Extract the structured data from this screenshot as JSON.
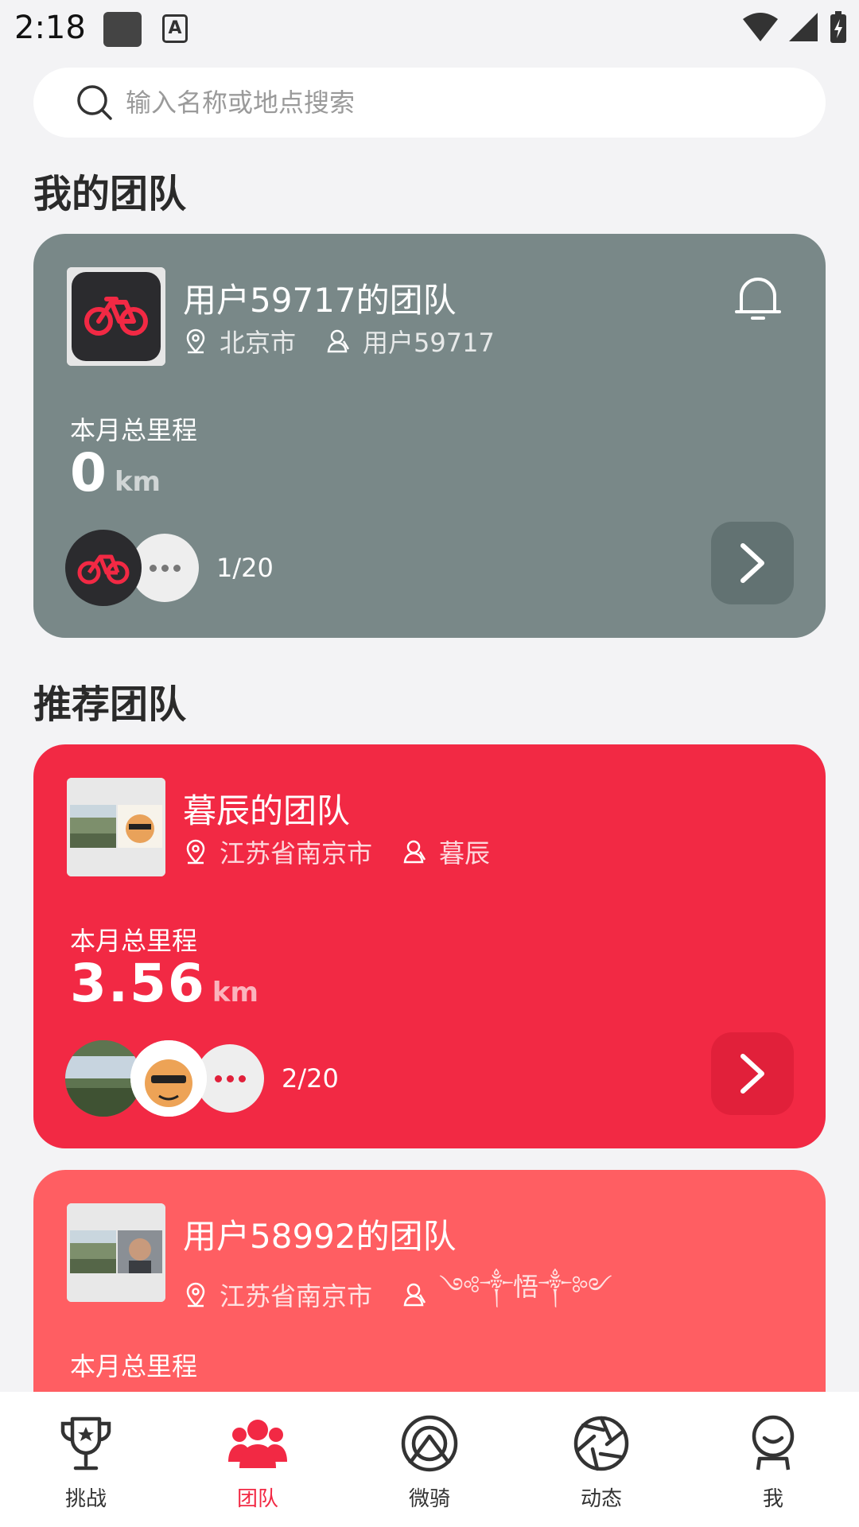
{
  "status_bar": {
    "time": "2:18"
  },
  "search": {
    "placeholder": "输入名称或地点搜索"
  },
  "sections": {
    "my_team": "我的团队",
    "recommended": "推荐团队"
  },
  "my_team": {
    "name": "用户59717的团队",
    "location": "北京市",
    "owner": "用户59717",
    "mileage_label": "本月总里程",
    "mileage_value": "0",
    "mileage_unit": "km",
    "members": "1/20",
    "color": "#798888"
  },
  "recommended": [
    {
      "name": "暮辰的团队",
      "location": "江苏省南京市",
      "owner": "暮辰",
      "mileage_label": "本月总里程",
      "mileage_value": "3.56",
      "mileage_unit": "km",
      "members": "2/20",
      "color": "#f22944"
    },
    {
      "name": "用户58992的团队",
      "location": "江苏省南京市",
      "owner": "༺༒悟༒༻",
      "mileage_label": "本月总里程",
      "color": "#ff5e62"
    }
  ],
  "tabbar": {
    "items": [
      {
        "label": "挑战",
        "icon": "trophy-icon"
      },
      {
        "label": "团队",
        "icon": "team-icon"
      },
      {
        "label": "微骑",
        "icon": "ride-icon"
      },
      {
        "label": "动态",
        "icon": "aperture-icon"
      },
      {
        "label": "我",
        "icon": "profile-icon"
      }
    ],
    "active_color": "#f22944"
  }
}
